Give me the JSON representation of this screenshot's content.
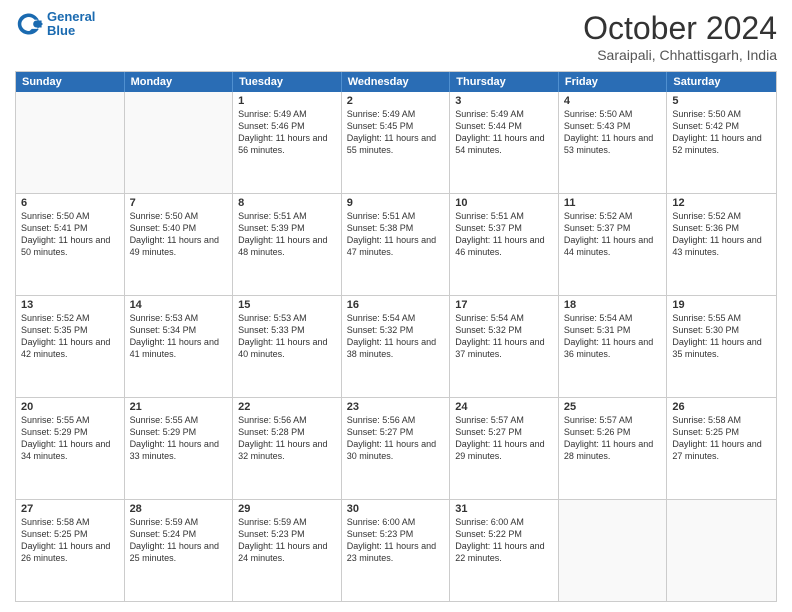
{
  "header": {
    "logo": {
      "line1": "General",
      "line2": "Blue"
    },
    "title": "October 2024",
    "subtitle": "Saraipali, Chhattisgarh, India"
  },
  "days_of_week": [
    "Sunday",
    "Monday",
    "Tuesday",
    "Wednesday",
    "Thursday",
    "Friday",
    "Saturday"
  ],
  "weeks": [
    [
      {
        "day": "",
        "sunrise": "",
        "sunset": "",
        "daylight": ""
      },
      {
        "day": "",
        "sunrise": "",
        "sunset": "",
        "daylight": ""
      },
      {
        "day": "1",
        "sunrise": "Sunrise: 5:49 AM",
        "sunset": "Sunset: 5:46 PM",
        "daylight": "Daylight: 11 hours and 56 minutes."
      },
      {
        "day": "2",
        "sunrise": "Sunrise: 5:49 AM",
        "sunset": "Sunset: 5:45 PM",
        "daylight": "Daylight: 11 hours and 55 minutes."
      },
      {
        "day": "3",
        "sunrise": "Sunrise: 5:49 AM",
        "sunset": "Sunset: 5:44 PM",
        "daylight": "Daylight: 11 hours and 54 minutes."
      },
      {
        "day": "4",
        "sunrise": "Sunrise: 5:50 AM",
        "sunset": "Sunset: 5:43 PM",
        "daylight": "Daylight: 11 hours and 53 minutes."
      },
      {
        "day": "5",
        "sunrise": "Sunrise: 5:50 AM",
        "sunset": "Sunset: 5:42 PM",
        "daylight": "Daylight: 11 hours and 52 minutes."
      }
    ],
    [
      {
        "day": "6",
        "sunrise": "Sunrise: 5:50 AM",
        "sunset": "Sunset: 5:41 PM",
        "daylight": "Daylight: 11 hours and 50 minutes."
      },
      {
        "day": "7",
        "sunrise": "Sunrise: 5:50 AM",
        "sunset": "Sunset: 5:40 PM",
        "daylight": "Daylight: 11 hours and 49 minutes."
      },
      {
        "day": "8",
        "sunrise": "Sunrise: 5:51 AM",
        "sunset": "Sunset: 5:39 PM",
        "daylight": "Daylight: 11 hours and 48 minutes."
      },
      {
        "day": "9",
        "sunrise": "Sunrise: 5:51 AM",
        "sunset": "Sunset: 5:38 PM",
        "daylight": "Daylight: 11 hours and 47 minutes."
      },
      {
        "day": "10",
        "sunrise": "Sunrise: 5:51 AM",
        "sunset": "Sunset: 5:37 PM",
        "daylight": "Daylight: 11 hours and 46 minutes."
      },
      {
        "day": "11",
        "sunrise": "Sunrise: 5:52 AM",
        "sunset": "Sunset: 5:37 PM",
        "daylight": "Daylight: 11 hours and 44 minutes."
      },
      {
        "day": "12",
        "sunrise": "Sunrise: 5:52 AM",
        "sunset": "Sunset: 5:36 PM",
        "daylight": "Daylight: 11 hours and 43 minutes."
      }
    ],
    [
      {
        "day": "13",
        "sunrise": "Sunrise: 5:52 AM",
        "sunset": "Sunset: 5:35 PM",
        "daylight": "Daylight: 11 hours and 42 minutes."
      },
      {
        "day": "14",
        "sunrise": "Sunrise: 5:53 AM",
        "sunset": "Sunset: 5:34 PM",
        "daylight": "Daylight: 11 hours and 41 minutes."
      },
      {
        "day": "15",
        "sunrise": "Sunrise: 5:53 AM",
        "sunset": "Sunset: 5:33 PM",
        "daylight": "Daylight: 11 hours and 40 minutes."
      },
      {
        "day": "16",
        "sunrise": "Sunrise: 5:54 AM",
        "sunset": "Sunset: 5:32 PM",
        "daylight": "Daylight: 11 hours and 38 minutes."
      },
      {
        "day": "17",
        "sunrise": "Sunrise: 5:54 AM",
        "sunset": "Sunset: 5:32 PM",
        "daylight": "Daylight: 11 hours and 37 minutes."
      },
      {
        "day": "18",
        "sunrise": "Sunrise: 5:54 AM",
        "sunset": "Sunset: 5:31 PM",
        "daylight": "Daylight: 11 hours and 36 minutes."
      },
      {
        "day": "19",
        "sunrise": "Sunrise: 5:55 AM",
        "sunset": "Sunset: 5:30 PM",
        "daylight": "Daylight: 11 hours and 35 minutes."
      }
    ],
    [
      {
        "day": "20",
        "sunrise": "Sunrise: 5:55 AM",
        "sunset": "Sunset: 5:29 PM",
        "daylight": "Daylight: 11 hours and 34 minutes."
      },
      {
        "day": "21",
        "sunrise": "Sunrise: 5:55 AM",
        "sunset": "Sunset: 5:29 PM",
        "daylight": "Daylight: 11 hours and 33 minutes."
      },
      {
        "day": "22",
        "sunrise": "Sunrise: 5:56 AM",
        "sunset": "Sunset: 5:28 PM",
        "daylight": "Daylight: 11 hours and 32 minutes."
      },
      {
        "day": "23",
        "sunrise": "Sunrise: 5:56 AM",
        "sunset": "Sunset: 5:27 PM",
        "daylight": "Daylight: 11 hours and 30 minutes."
      },
      {
        "day": "24",
        "sunrise": "Sunrise: 5:57 AM",
        "sunset": "Sunset: 5:27 PM",
        "daylight": "Daylight: 11 hours and 29 minutes."
      },
      {
        "day": "25",
        "sunrise": "Sunrise: 5:57 AM",
        "sunset": "Sunset: 5:26 PM",
        "daylight": "Daylight: 11 hours and 28 minutes."
      },
      {
        "day": "26",
        "sunrise": "Sunrise: 5:58 AM",
        "sunset": "Sunset: 5:25 PM",
        "daylight": "Daylight: 11 hours and 27 minutes."
      }
    ],
    [
      {
        "day": "27",
        "sunrise": "Sunrise: 5:58 AM",
        "sunset": "Sunset: 5:25 PM",
        "daylight": "Daylight: 11 hours and 26 minutes."
      },
      {
        "day": "28",
        "sunrise": "Sunrise: 5:59 AM",
        "sunset": "Sunset: 5:24 PM",
        "daylight": "Daylight: 11 hours and 25 minutes."
      },
      {
        "day": "29",
        "sunrise": "Sunrise: 5:59 AM",
        "sunset": "Sunset: 5:23 PM",
        "daylight": "Daylight: 11 hours and 24 minutes."
      },
      {
        "day": "30",
        "sunrise": "Sunrise: 6:00 AM",
        "sunset": "Sunset: 5:23 PM",
        "daylight": "Daylight: 11 hours and 23 minutes."
      },
      {
        "day": "31",
        "sunrise": "Sunrise: 6:00 AM",
        "sunset": "Sunset: 5:22 PM",
        "daylight": "Daylight: 11 hours and 22 minutes."
      },
      {
        "day": "",
        "sunrise": "",
        "sunset": "",
        "daylight": ""
      },
      {
        "day": "",
        "sunrise": "",
        "sunset": "",
        "daylight": ""
      }
    ]
  ]
}
